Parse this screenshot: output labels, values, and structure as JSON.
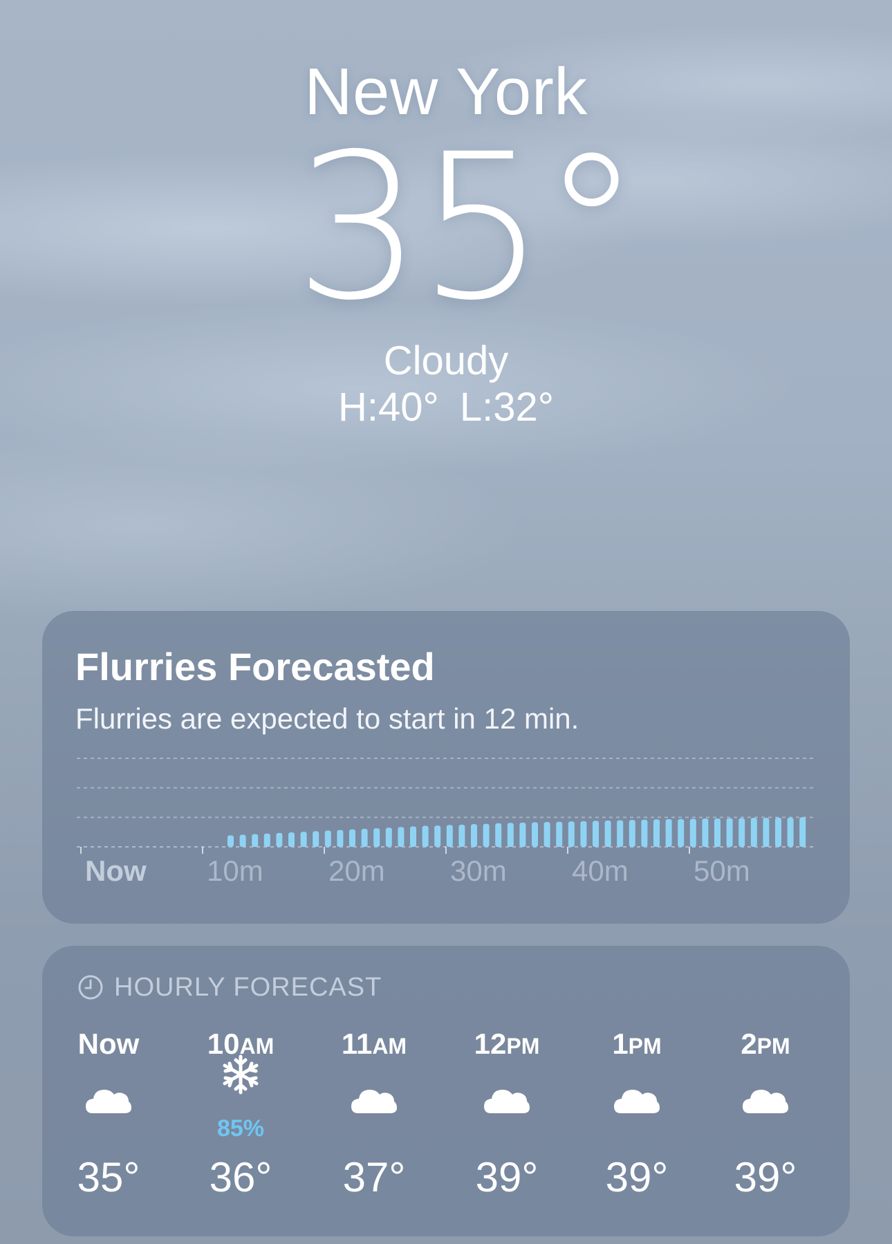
{
  "location": {
    "city": "New York",
    "temperature": "35°",
    "condition": "Cloudy",
    "high_low": "H:40°  L:32°"
  },
  "alert_card": {
    "title": "Flurries Forecasted",
    "subtitle": "Flurries are expected to start in 12 min.",
    "chart_data": {
      "type": "bar",
      "x_tick_labels": [
        "Now",
        "10m",
        "20m",
        "30m",
        "40m",
        "50m"
      ],
      "start_minute": 12,
      "end_minute": 60,
      "intensity_levels": 3,
      "values": [
        0.25,
        0.27,
        0.29,
        0.31,
        0.33,
        0.35,
        0.37,
        0.39,
        0.41,
        0.43,
        0.45,
        0.47,
        0.49,
        0.51,
        0.53,
        0.55,
        0.57,
        0.58,
        0.6,
        0.61,
        0.63,
        0.64,
        0.66,
        0.67,
        0.68,
        0.69,
        0.7,
        0.71,
        0.72,
        0.73,
        0.74,
        0.75,
        0.76,
        0.77,
        0.78,
        0.79,
        0.8,
        0.8,
        0.81,
        0.82,
        0.82,
        0.83,
        0.83,
        0.84,
        0.84,
        0.85,
        0.85,
        0.86
      ],
      "grid": "dashed",
      "bar_color": "#8fd3f4"
    }
  },
  "hourly": {
    "header": "HOURLY FORECAST",
    "header_icon": "clock-icon",
    "hours": [
      {
        "time": "Now",
        "suffix": "",
        "icon": "cloud-icon",
        "precip": "",
        "temp": "35°"
      },
      {
        "time": "10",
        "suffix": "AM",
        "icon": "snowflake-icon",
        "precip": "85%",
        "temp": "36°"
      },
      {
        "time": "11",
        "suffix": "AM",
        "icon": "cloud-icon",
        "precip": "",
        "temp": "37°"
      },
      {
        "time": "12",
        "suffix": "PM",
        "icon": "cloud-icon",
        "precip": "",
        "temp": "39°"
      },
      {
        "time": "1",
        "suffix": "PM",
        "icon": "cloud-icon",
        "precip": "",
        "temp": "39°"
      },
      {
        "time": "2",
        "suffix": "PM",
        "icon": "cloud-icon",
        "precip": "",
        "temp": "39°"
      }
    ]
  },
  "colors": {
    "precip_accent": "#6fc6f2",
    "card_background": "#6c7c94"
  }
}
